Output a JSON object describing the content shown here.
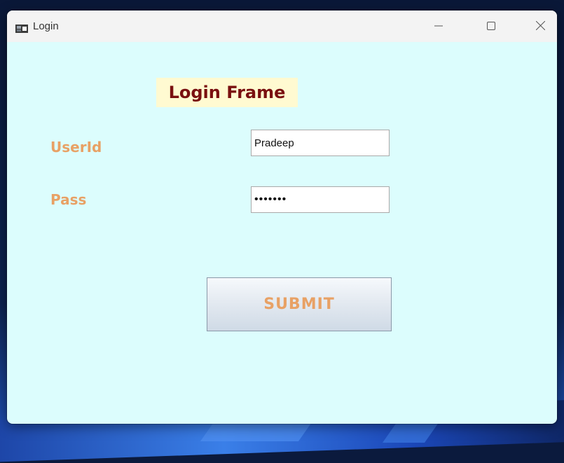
{
  "window": {
    "title": "Login",
    "controls": {
      "minimize": "minimize-icon",
      "maximize": "maximize-icon",
      "close": "close-icon"
    }
  },
  "form": {
    "heading": "Login Frame",
    "userid_label": "UserId",
    "pass_label": "Pass",
    "userid_value": "Pradeep",
    "pass_value": "•••••••",
    "submit_label": "SUBMIT"
  },
  "colors": {
    "window_background": "#dcfdfd",
    "heading_background": "#fffad1",
    "heading_text": "#7a1010",
    "label_text": "#e8a165",
    "submit_text": "#e8a165"
  }
}
